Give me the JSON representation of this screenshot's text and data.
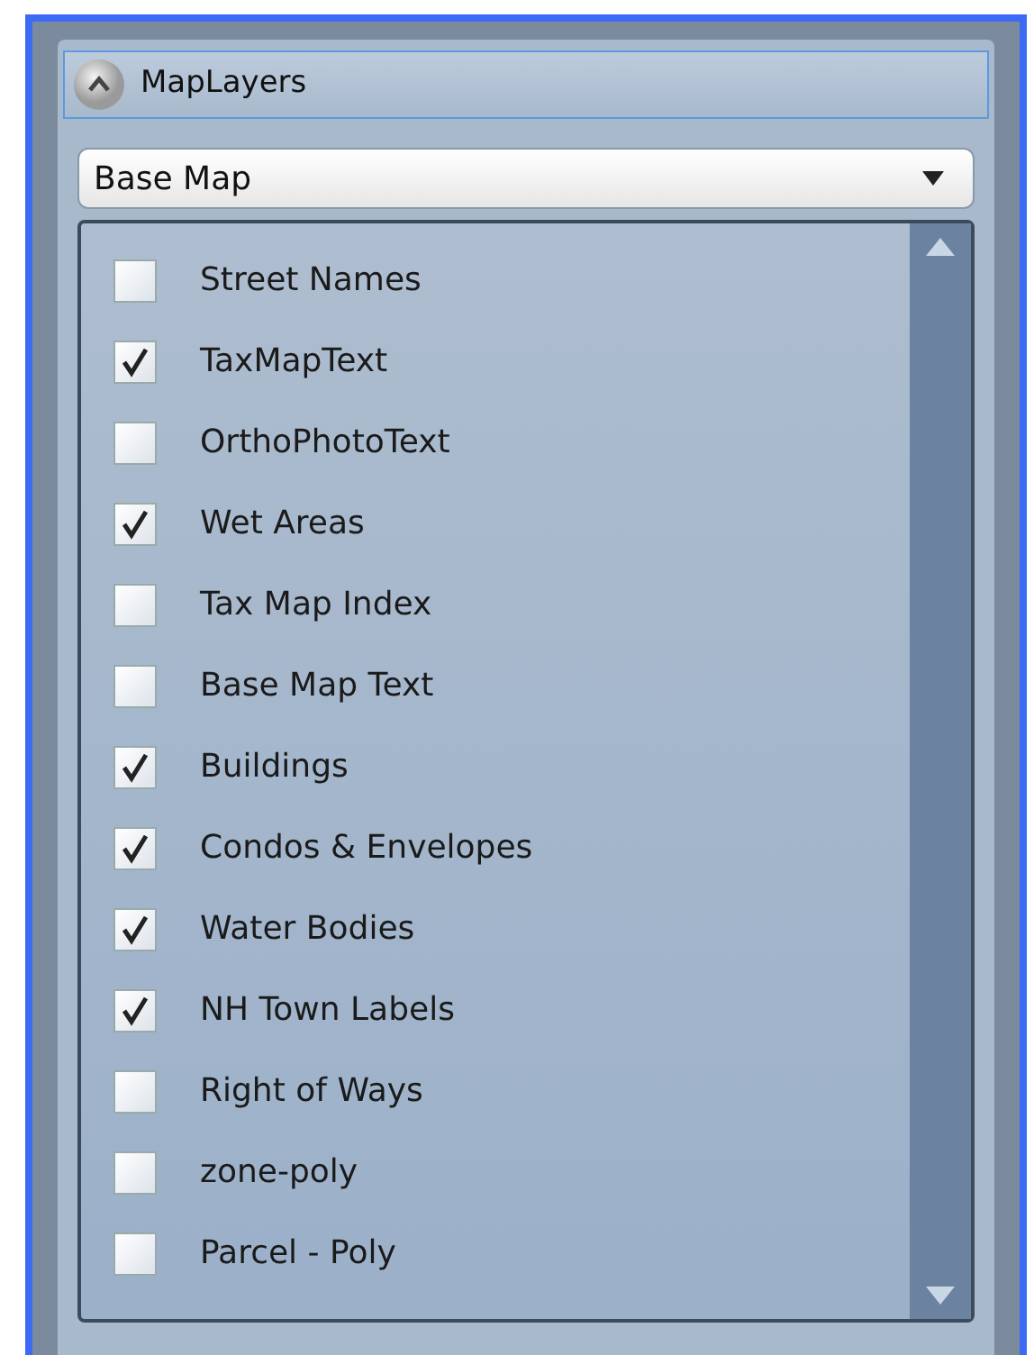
{
  "panel": {
    "title": "MapLayers",
    "expanded": true
  },
  "dropdown": {
    "value": "Base Map"
  },
  "layers": [
    {
      "label": "Street Names",
      "checked": false
    },
    {
      "label": "TaxMapText",
      "checked": true
    },
    {
      "label": "OrthoPhotoText",
      "checked": false
    },
    {
      "label": "Wet Areas",
      "checked": true
    },
    {
      "label": "Tax Map Index",
      "checked": false
    },
    {
      "label": "Base Map Text",
      "checked": false
    },
    {
      "label": "Buildings",
      "checked": true
    },
    {
      "label": "Condos & Envelopes",
      "checked": true
    },
    {
      "label": "Water Bodies",
      "checked": true
    },
    {
      "label": "NH Town Labels",
      "checked": true
    },
    {
      "label": "Right of Ways",
      "checked": false
    },
    {
      "label": "zone-poly",
      "checked": false
    },
    {
      "label": "Parcel - Poly",
      "checked": false
    }
  ]
}
